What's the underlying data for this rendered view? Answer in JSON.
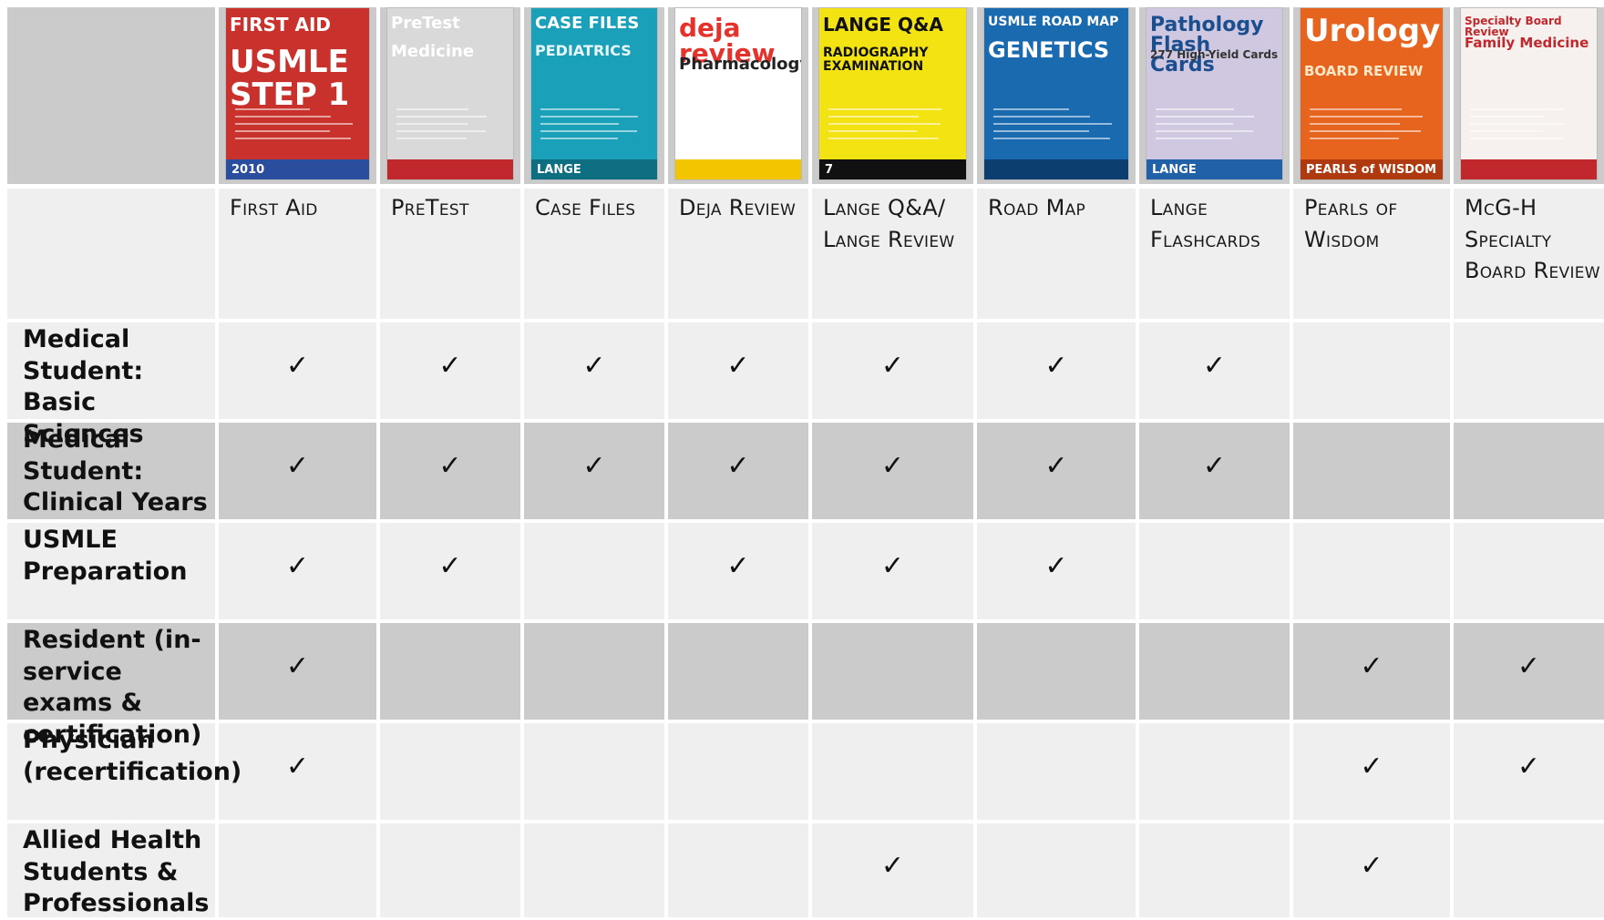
{
  "columns": [
    {
      "name": "First Aid",
      "cover": {
        "title": "FIRST AID",
        "subtitle": "USMLE STEP 1",
        "badge": "2010",
        "icon": "first-aid-cover"
      }
    },
    {
      "name": "PreTest",
      "cover": {
        "title": "PreTest",
        "subtitle": "Medicine",
        "icon": "pretest-cover"
      }
    },
    {
      "name": "Case Files",
      "cover": {
        "title": "CASE FILES",
        "subtitle": "PEDIATRICS",
        "badge": "LANGE",
        "icon": "case-files-cover"
      }
    },
    {
      "name": "Deja Review",
      "cover": {
        "title": "deja review",
        "subtitle": "Pharmacology",
        "icon": "deja-review-cover"
      }
    },
    {
      "name": "Lange Q&A/ Lange Review",
      "cover": {
        "title": "LANGE Q&A",
        "subtitle": "RADIOGRAPHY EXAMINATION",
        "badge": "7",
        "icon": "lange-qa-cover"
      }
    },
    {
      "name": "Road Map",
      "cover": {
        "title": "USMLE ROAD MAP",
        "subtitle": "GENETICS",
        "icon": "road-map-cover"
      }
    },
    {
      "name": "Lange Flashcards",
      "cover": {
        "title": "Pathology Flash Cards",
        "subtitle": "277 High-Yield Cards",
        "badge": "LANGE",
        "icon": "lange-flashcards-cover"
      }
    },
    {
      "name": "Pearls of Wisdom",
      "cover": {
        "title": "Urology",
        "subtitle": "BOARD REVIEW",
        "badge": "PEARLS of WISDOM",
        "icon": "pearls-cover"
      }
    },
    {
      "name": "McG-H Specialty Board Review",
      "cover": {
        "title": "Specialty Board Review",
        "subtitle": "Family Medicine",
        "icon": "specialty-board-cover"
      }
    }
  ],
  "rows": [
    {
      "label": "Medical Student: Basic Sciences",
      "checks": [
        true,
        true,
        true,
        true,
        true,
        true,
        true,
        false,
        false
      ]
    },
    {
      "label": "Medical Student: Clinical Years",
      "checks": [
        true,
        true,
        true,
        true,
        true,
        true,
        true,
        false,
        false
      ]
    },
    {
      "label": "USMLE Preparation",
      "checks": [
        true,
        true,
        false,
        true,
        true,
        true,
        false,
        false,
        false
      ]
    },
    {
      "label": "Resident (in-service exams & certification)",
      "checks": [
        true,
        false,
        false,
        false,
        false,
        false,
        false,
        true,
        true
      ]
    },
    {
      "label": "Physician (recertification)",
      "checks": [
        true,
        false,
        false,
        false,
        false,
        false,
        false,
        true,
        true
      ]
    },
    {
      "label": "Allied Health Students & Professionals",
      "checks": [
        false,
        false,
        false,
        false,
        true,
        false,
        false,
        true,
        false
      ]
    }
  ],
  "check_symbol": "✓",
  "colors": {
    "light_cell": "#efefef",
    "dark_cell": "#cbcbcb",
    "text": "#111111"
  }
}
